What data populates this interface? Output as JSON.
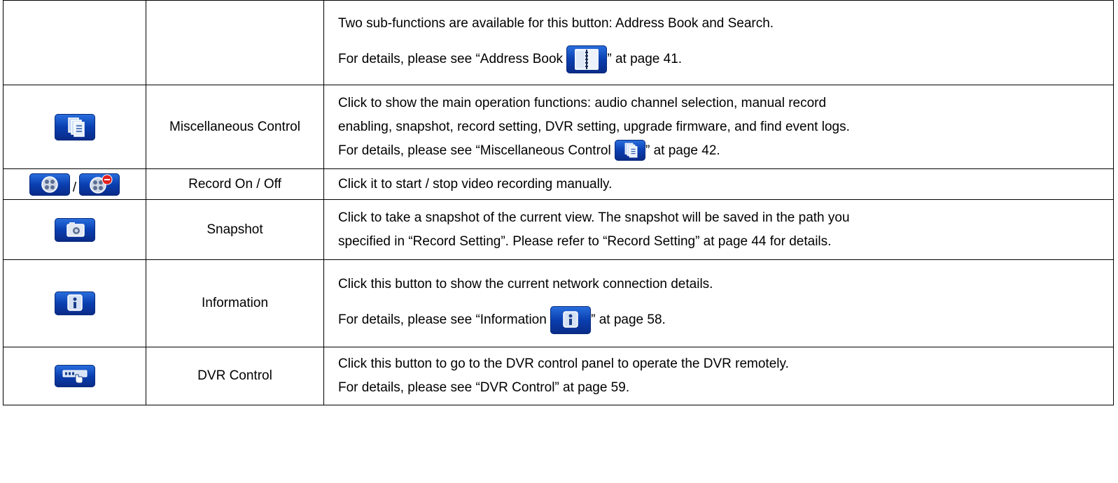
{
  "rows": [
    {
      "icon": "",
      "name": "",
      "lines": [
        "Two sub-functions are available for this button: Address Book and Search."
      ],
      "detail": {
        "prefix": "For details, please see “Address Book ",
        "icon": "address-book-icon",
        "suffix": "” at page 41."
      }
    },
    {
      "icon": "miscellaneous-control-icon",
      "name": "Miscellaneous Control",
      "lines": [
        "Click to show the main operation functions: audio channel selection, manual record",
        "enabling, snapshot, record setting, DVR setting, upgrade firmware, and find event logs."
      ],
      "detail": {
        "prefix": "For details, please see “Miscellaneous Control ",
        "icon": "miscellaneous-control-icon",
        "suffix": "” at page 42."
      }
    },
    {
      "icon": "record-on-icon",
      "icon_separator": "/",
      "icon2": "record-off-icon",
      "name": "Record On / Off",
      "lines": [
        "Click it to start / stop video recording manually."
      ]
    },
    {
      "icon": "snapshot-icon",
      "name": "Snapshot",
      "lines": [
        "Click to take a snapshot of the current view. The snapshot will be saved in the path you",
        "specified in “Record Setting”. Please refer to “Record Setting” at page 44 for details."
      ]
    },
    {
      "icon": "information-icon",
      "name": "Information",
      "lines": [
        "Click this button to show the current network connection details."
      ],
      "detail": {
        "prefix": "For details, please see “Information ",
        "icon": "information-icon",
        "suffix": "” at page 58."
      }
    },
    {
      "icon": "dvr-control-icon",
      "name": "DVR Control",
      "lines": [
        "Click this button to go to the DVR control panel to operate the DVR remotely.",
        "For details, please see “DVR Control” at page 59."
      ]
    }
  ]
}
